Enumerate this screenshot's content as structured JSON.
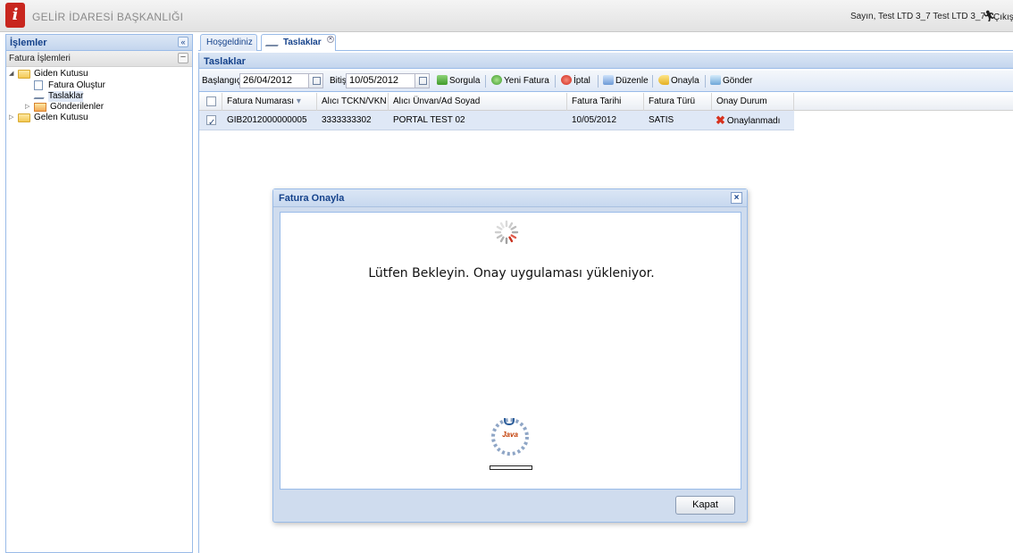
{
  "header": {
    "org_title": "GELİR İDARESİ BAŞKANLIĞI",
    "greeting": "Sayın, Test LTD 3_7 Test LTD 3_7",
    "logout_label": "Çıkış",
    "logo_letter": "i",
    "brand_color": "#c8261e"
  },
  "sidebar": {
    "title": "İşlemler",
    "collapse_icon": "«",
    "section_title": "Fatura İşlemleri",
    "section_collapse_icon": "−",
    "tree": [
      {
        "label": "Giden Kutusu",
        "icon": "folder-icon",
        "expanded": true
      },
      {
        "label": "Fatura Oluştur",
        "icon": "document-icon"
      },
      {
        "label": "Taslaklar",
        "icon": "draft-icon",
        "selected": true
      },
      {
        "label": "Gönderilenler",
        "icon": "sent-folder-icon",
        "expanded": false
      },
      {
        "label": "Gelen Kutusu",
        "icon": "folder-icon",
        "expanded": false
      }
    ]
  },
  "tabs": [
    {
      "label": "Hoşgeldiniz",
      "active": false
    },
    {
      "label": "Taslaklar",
      "active": true
    }
  ],
  "content": {
    "title": "Taslaklar",
    "toolbar": {
      "start_label": "Başlangıç",
      "start_value": "26/04/2012",
      "end_label": "Bitiş",
      "end_value": "10/05/2012",
      "buttons": [
        "Sorgula",
        "Yeni Fatura",
        "İptal",
        "Düzenle",
        "Onayla",
        "Gönder"
      ]
    },
    "grid": {
      "columns": [
        "Fatura Numarası",
        "Alıcı TCKN/VKN",
        "Alıcı Ünvan/Ad Soyad",
        "Fatura Tarihi",
        "Fatura Türü",
        "Onay Durum"
      ],
      "sort_indicator": "▾",
      "rows": [
        {
          "checked": true,
          "invoice_no": "GIB2012000000005",
          "tckn": "3333333302",
          "name": "PORTAL TEST 02",
          "date": "10/05/2012",
          "type": "SATIS",
          "status": "Onaylanmadı"
        }
      ]
    }
  },
  "dialog": {
    "title": "Fatura Onayla",
    "close_icon": "×",
    "loading_text": "Lütfen Bekleyin. Onay uygulaması yükleniyor.",
    "java_label": "Java",
    "ok_label": "Kapat"
  }
}
